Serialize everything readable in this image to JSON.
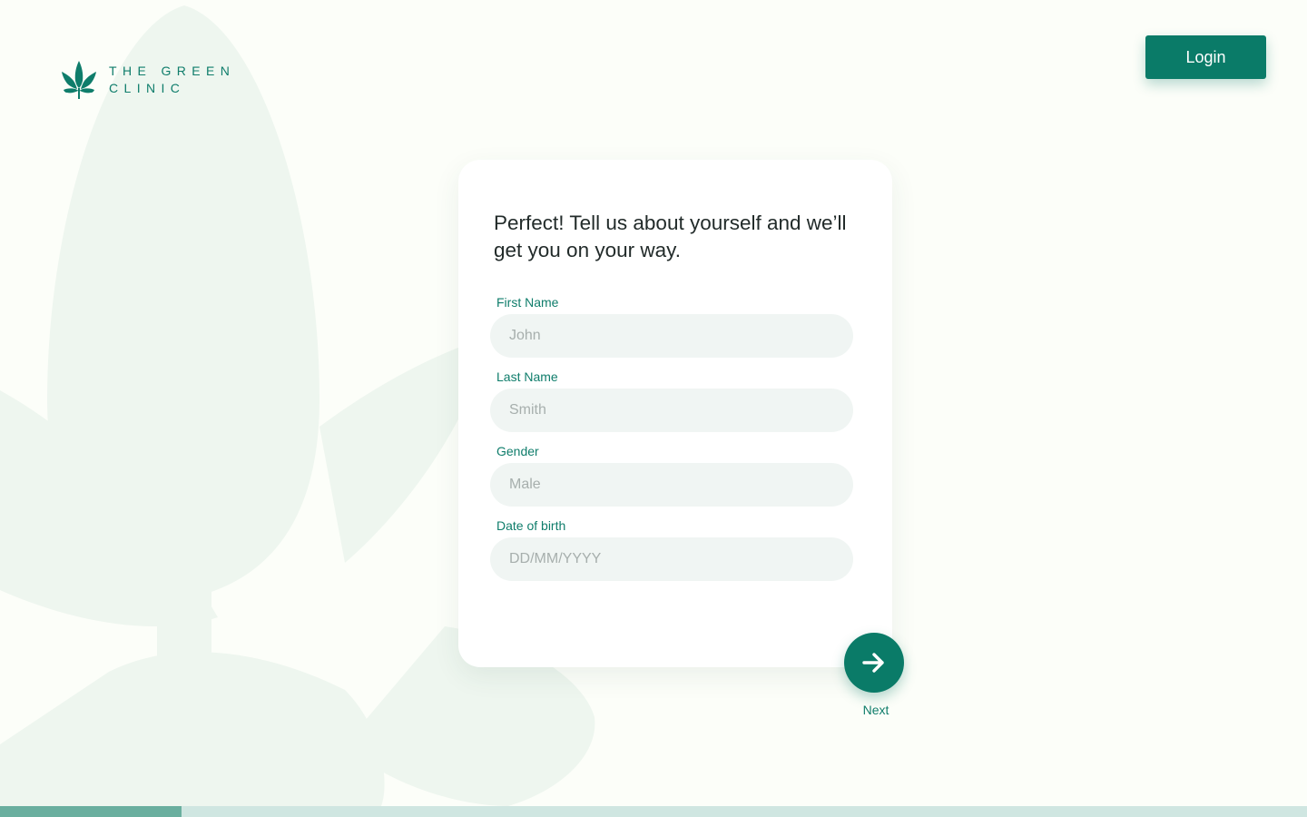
{
  "brand": {
    "line1": "THE GREEN",
    "line2": "CLINIC",
    "icon": "cannabis-leaf-icon"
  },
  "header": {
    "login_label": "Login"
  },
  "form": {
    "heading": "Perfect! Tell us about yourself and we’ll get you on your way.",
    "fields": [
      {
        "label": "First Name",
        "placeholder": "John"
      },
      {
        "label": "Last Name",
        "placeholder": "Smith"
      },
      {
        "label": "Gender",
        "placeholder": "Male"
      },
      {
        "label": "Date of birth",
        "placeholder": "DD/MM/YYYY"
      }
    ],
    "next_label": "Next",
    "next_icon": "arrow-right-icon"
  },
  "progress": {
    "fraction": 0.139
  },
  "colors": {
    "accent": "#0a7b68",
    "accent_text": "#0f7d6b",
    "background": "#fcfef9",
    "input_bg": "#f0f5f3",
    "progress_fill": "#6aaf9f",
    "progress_track": "#cfe6e1"
  }
}
